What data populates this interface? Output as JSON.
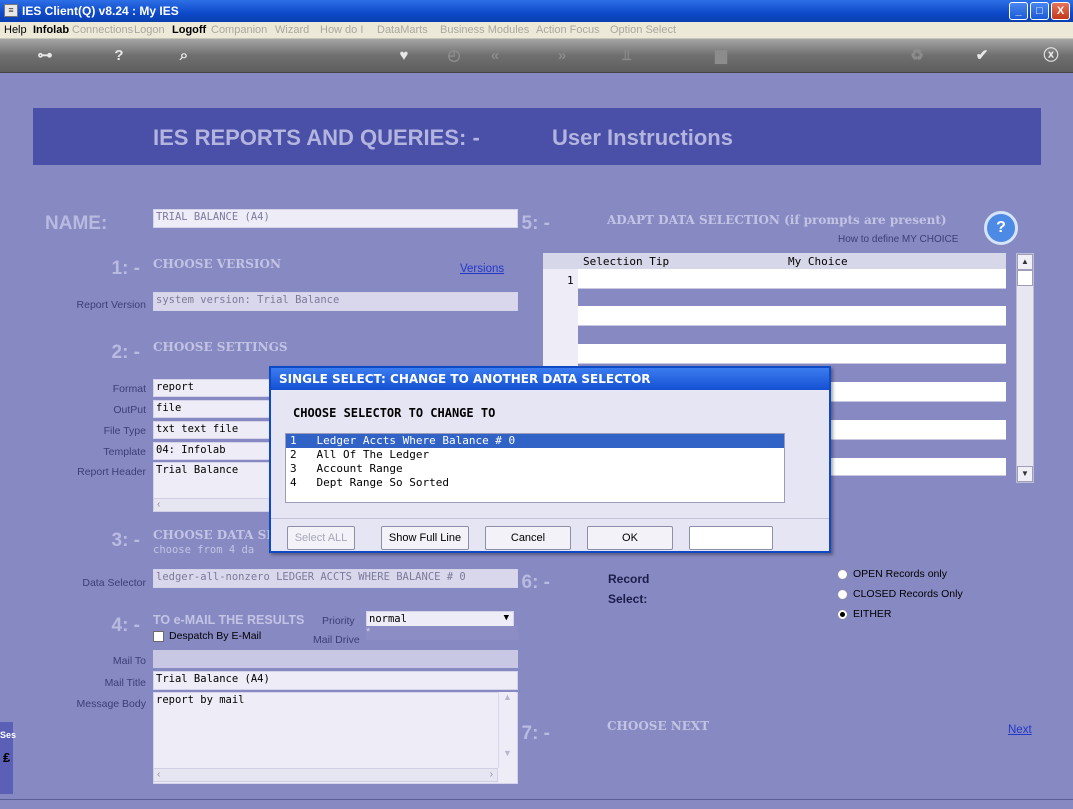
{
  "window": {
    "title": "IES Client(Q) v8.24 : My IES",
    "icon": "app-icon",
    "controls": {
      "minimize": "_",
      "maximize": "□",
      "close": "X"
    }
  },
  "menu": {
    "items": [
      "Help",
      "Infolab",
      "Connections",
      "Logon",
      "Logoff",
      "Companion",
      "Wizard",
      "How do I",
      "DataMarts",
      "Business Modules",
      "Action Focus",
      "Option Select"
    ]
  },
  "toolbar": {
    "icons": [
      "key-icon",
      "help-icon",
      "search-icon",
      "heart-icon",
      "clock-icon",
      "back-icon",
      "forward-icon",
      "tool-icon",
      "monitor-icon",
      "recycle-icon",
      "check-icon",
      "close-icon"
    ]
  },
  "banner": {
    "title": "IES REPORTS AND QUERIES: -",
    "subtitle": "User Instructions"
  },
  "left": {
    "name_label": "NAME:",
    "name_value": "TRIAL BALANCE (A4)",
    "step1": {
      "num": "1: -",
      "title": "CHOOSE VERSION",
      "link": "Versions"
    },
    "report_version_label": "Report Version",
    "report_version_value": "system version: Trial Balance",
    "step2": {
      "num": "2: -",
      "title": "CHOOSE SETTINGS"
    },
    "settings": [
      {
        "label": "Format",
        "value": "report"
      },
      {
        "label": "OutPut",
        "value": "file"
      },
      {
        "label": "File Type",
        "value": "txt text file"
      },
      {
        "label": "Template",
        "value": "04: Infolab"
      },
      {
        "label": "Report Header",
        "value": "Trial Balance"
      }
    ],
    "step3": {
      "num": "3: -",
      "title": "CHOOSE DATA SE",
      "sub": "choose from 4 da"
    },
    "data_selector_label": "Data Selector",
    "data_selector_value": "ledger-all-nonzero LEDGER ACCTS WHERE BALANCE # 0",
    "step4": {
      "num": "4: -",
      "title": "TO e-MAIL THE RESULTS",
      "priority_label": "Priority",
      "priority_value": "normal",
      "despatch_label": "Despatch By E-Mail",
      "mail_drive_label": "Mail Drive",
      "mail_drive_value": "*"
    },
    "mail_to_label": "Mail To",
    "mail_title_label": "Mail Title",
    "mail_title_value": "Trial Balance (A4)",
    "message_body_label": "Message Body",
    "message_body_value": "report by mail",
    "side_text": "Ses"
  },
  "right": {
    "step5": {
      "num": "5: -",
      "title": "ADAPT DATA SELECTION",
      "title_suffix": "(if prompts are present)",
      "help_link": "How to define MY CHOICE"
    },
    "grid": {
      "col_tip": "Selection Tip",
      "col_choice": "My Choice",
      "row_num": "1"
    },
    "step6": {
      "num": "6: -",
      "title_a": "Record",
      "title_b": "Select:"
    },
    "radios": [
      {
        "label": "OPEN Records only",
        "checked": false
      },
      {
        "label": "CLOSED Records Only",
        "checked": false
      },
      {
        "label": "EITHER",
        "checked": true
      }
    ],
    "step7": {
      "num": "7: -",
      "title": "CHOOSE NEXT",
      "next_link": "Next"
    }
  },
  "dialog": {
    "title": "SINGLE SELECT: CHANGE TO ANOTHER DATA SELECTOR",
    "heading": "CHOOSE SELECTOR TO CHANGE TO",
    "items": [
      {
        "num": "1",
        "text": "Ledger Accts Where Balance # 0",
        "selected": true
      },
      {
        "num": "2",
        "text": "All Of The Ledger",
        "selected": false
      },
      {
        "num": "3",
        "text": "Account Range",
        "selected": false
      },
      {
        "num": "4",
        "text": "Dept Range So Sorted",
        "selected": false
      }
    ],
    "buttons": {
      "select_all": "Select ALL",
      "show_full_line": "Show Full Line",
      "cancel": "Cancel",
      "ok": "OK"
    },
    "input_value": ""
  }
}
